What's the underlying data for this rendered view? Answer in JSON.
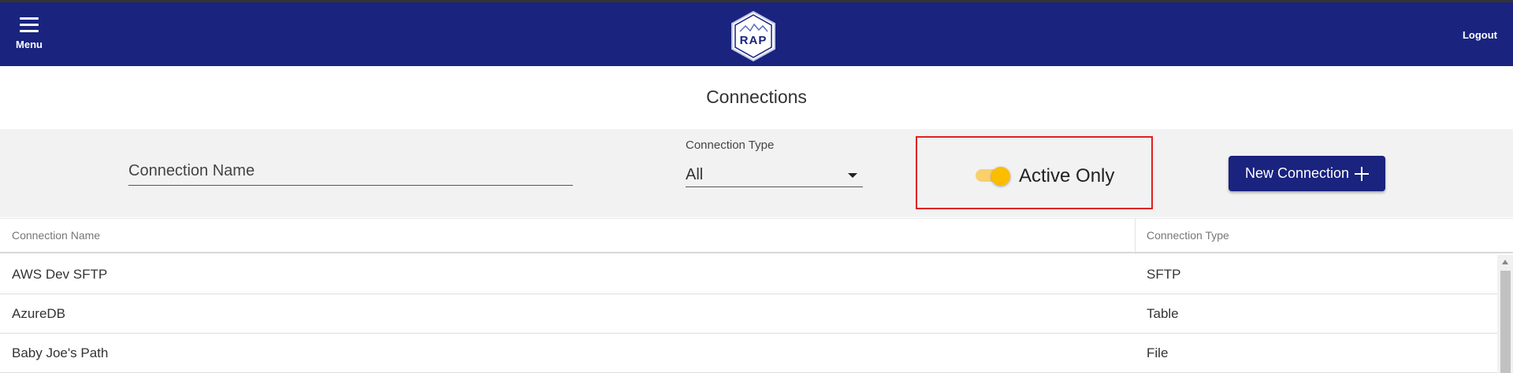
{
  "header": {
    "menu_label": "Menu",
    "logo_text": "RAP",
    "logout_label": "Logout"
  },
  "page": {
    "title": "Connections"
  },
  "filters": {
    "name_placeholder": "Connection Name",
    "type_label": "Connection Type",
    "type_value": "All",
    "active_label": "Active Only",
    "active_on": true,
    "new_button_label": "New Connection"
  },
  "table": {
    "columns": [
      "Connection Name",
      "Connection Type"
    ],
    "rows": [
      {
        "name": "AWS Dev SFTP",
        "type": "SFTP"
      },
      {
        "name": "AzureDB",
        "type": "Table"
      },
      {
        "name": "Baby Joe's Path",
        "type": "File"
      }
    ]
  },
  "colors": {
    "brand": "#1a237e",
    "toggle": "#fbbd00",
    "highlight": "#e02020"
  }
}
